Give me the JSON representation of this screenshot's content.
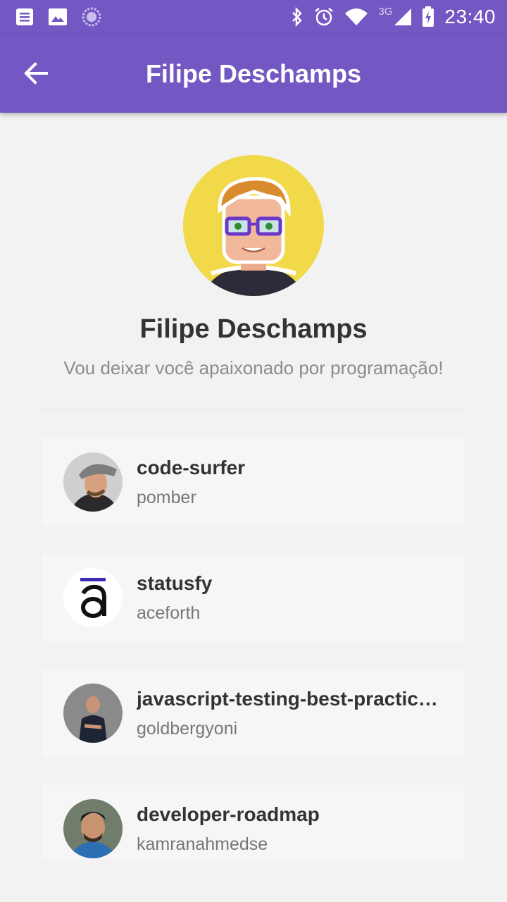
{
  "status_bar": {
    "time": "23:40",
    "network": "3G",
    "icons": [
      "notes-icon",
      "image-icon",
      "sync-icon",
      "bluetooth-icon",
      "alarm-icon",
      "wifi-icon",
      "signal-icon",
      "battery-icon"
    ]
  },
  "app_bar": {
    "title": "Filipe Deschamps",
    "back_icon": "arrow-back-icon",
    "color": "#7357c2"
  },
  "profile": {
    "name": "Filipe Deschamps",
    "bio": "Vou deixar você apaixonado por programação!",
    "avatar_bg": "#f1d94a"
  },
  "repos": [
    {
      "name": "code-surfer",
      "owner": "pomber"
    },
    {
      "name": "statusfy",
      "owner": "aceforth"
    },
    {
      "name": "javascript-testing-best-practic…",
      "owner": "goldbergyoni"
    },
    {
      "name": "developer-roadmap",
      "owner": "kamranahmedse"
    }
  ]
}
